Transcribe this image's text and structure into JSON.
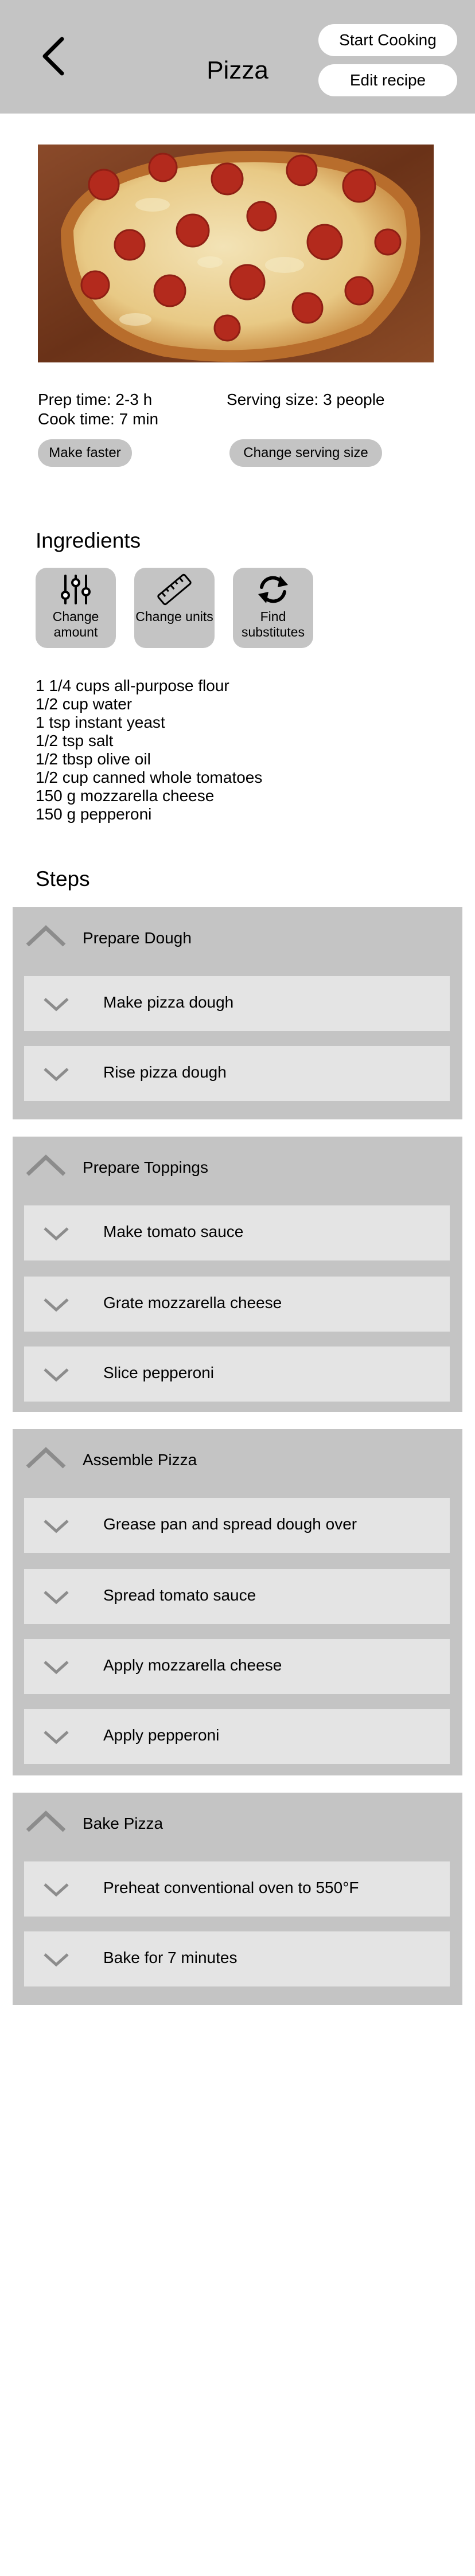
{
  "header": {
    "title": "Pizza",
    "start_cooking_label": "Start Cooking",
    "edit_recipe_label": "Edit recipe"
  },
  "info": {
    "prep_time": "Prep time: 2-3 h",
    "cook_time": "Cook time: 7 min",
    "serving_size": "Serving size: 3 people",
    "make_faster_label": "Make faster",
    "change_serving_label": "Change serving size"
  },
  "ingredients": {
    "title": "Ingredients",
    "tools": [
      {
        "label": "Change amount",
        "icon": "sliders-icon"
      },
      {
        "label": "Change units",
        "icon": "ruler-icon"
      },
      {
        "label": "Find substitutes",
        "icon": "refresh-icon"
      }
    ],
    "items": [
      "1 1/4 cups all-purpose flour",
      "1/2 cup water",
      "1 tsp instant yeast",
      "1/2 tsp salt",
      "1/2 tbsp olive oil",
      "1/2 cup canned whole tomatoes",
      "150 g mozzarella cheese",
      "150 g pepperoni"
    ]
  },
  "steps": {
    "title": "Steps",
    "groups": [
      {
        "title": "Prepare Dough",
        "steps": [
          "Make pizza dough",
          "Rise pizza dough"
        ]
      },
      {
        "title": "Prepare Toppings",
        "steps": [
          "Make tomato sauce",
          "Grate mozzarella cheese",
          "Slice pepperoni"
        ]
      },
      {
        "title": "Assemble Pizza",
        "steps": [
          "Grease pan and spread dough over",
          "Spread tomato sauce",
          "Apply mozzarella cheese",
          "Apply pepperoni"
        ]
      },
      {
        "title": "Bake Pizza",
        "steps": [
          "Preheat conventional oven to 550°F",
          "Bake for 7 minutes"
        ]
      }
    ]
  },
  "colors": {
    "header_bg": "#c4c4c4",
    "group_bg": "#c4c4c4",
    "step_bg": "#e4e4e4",
    "chevron": "#8c8c8c"
  }
}
